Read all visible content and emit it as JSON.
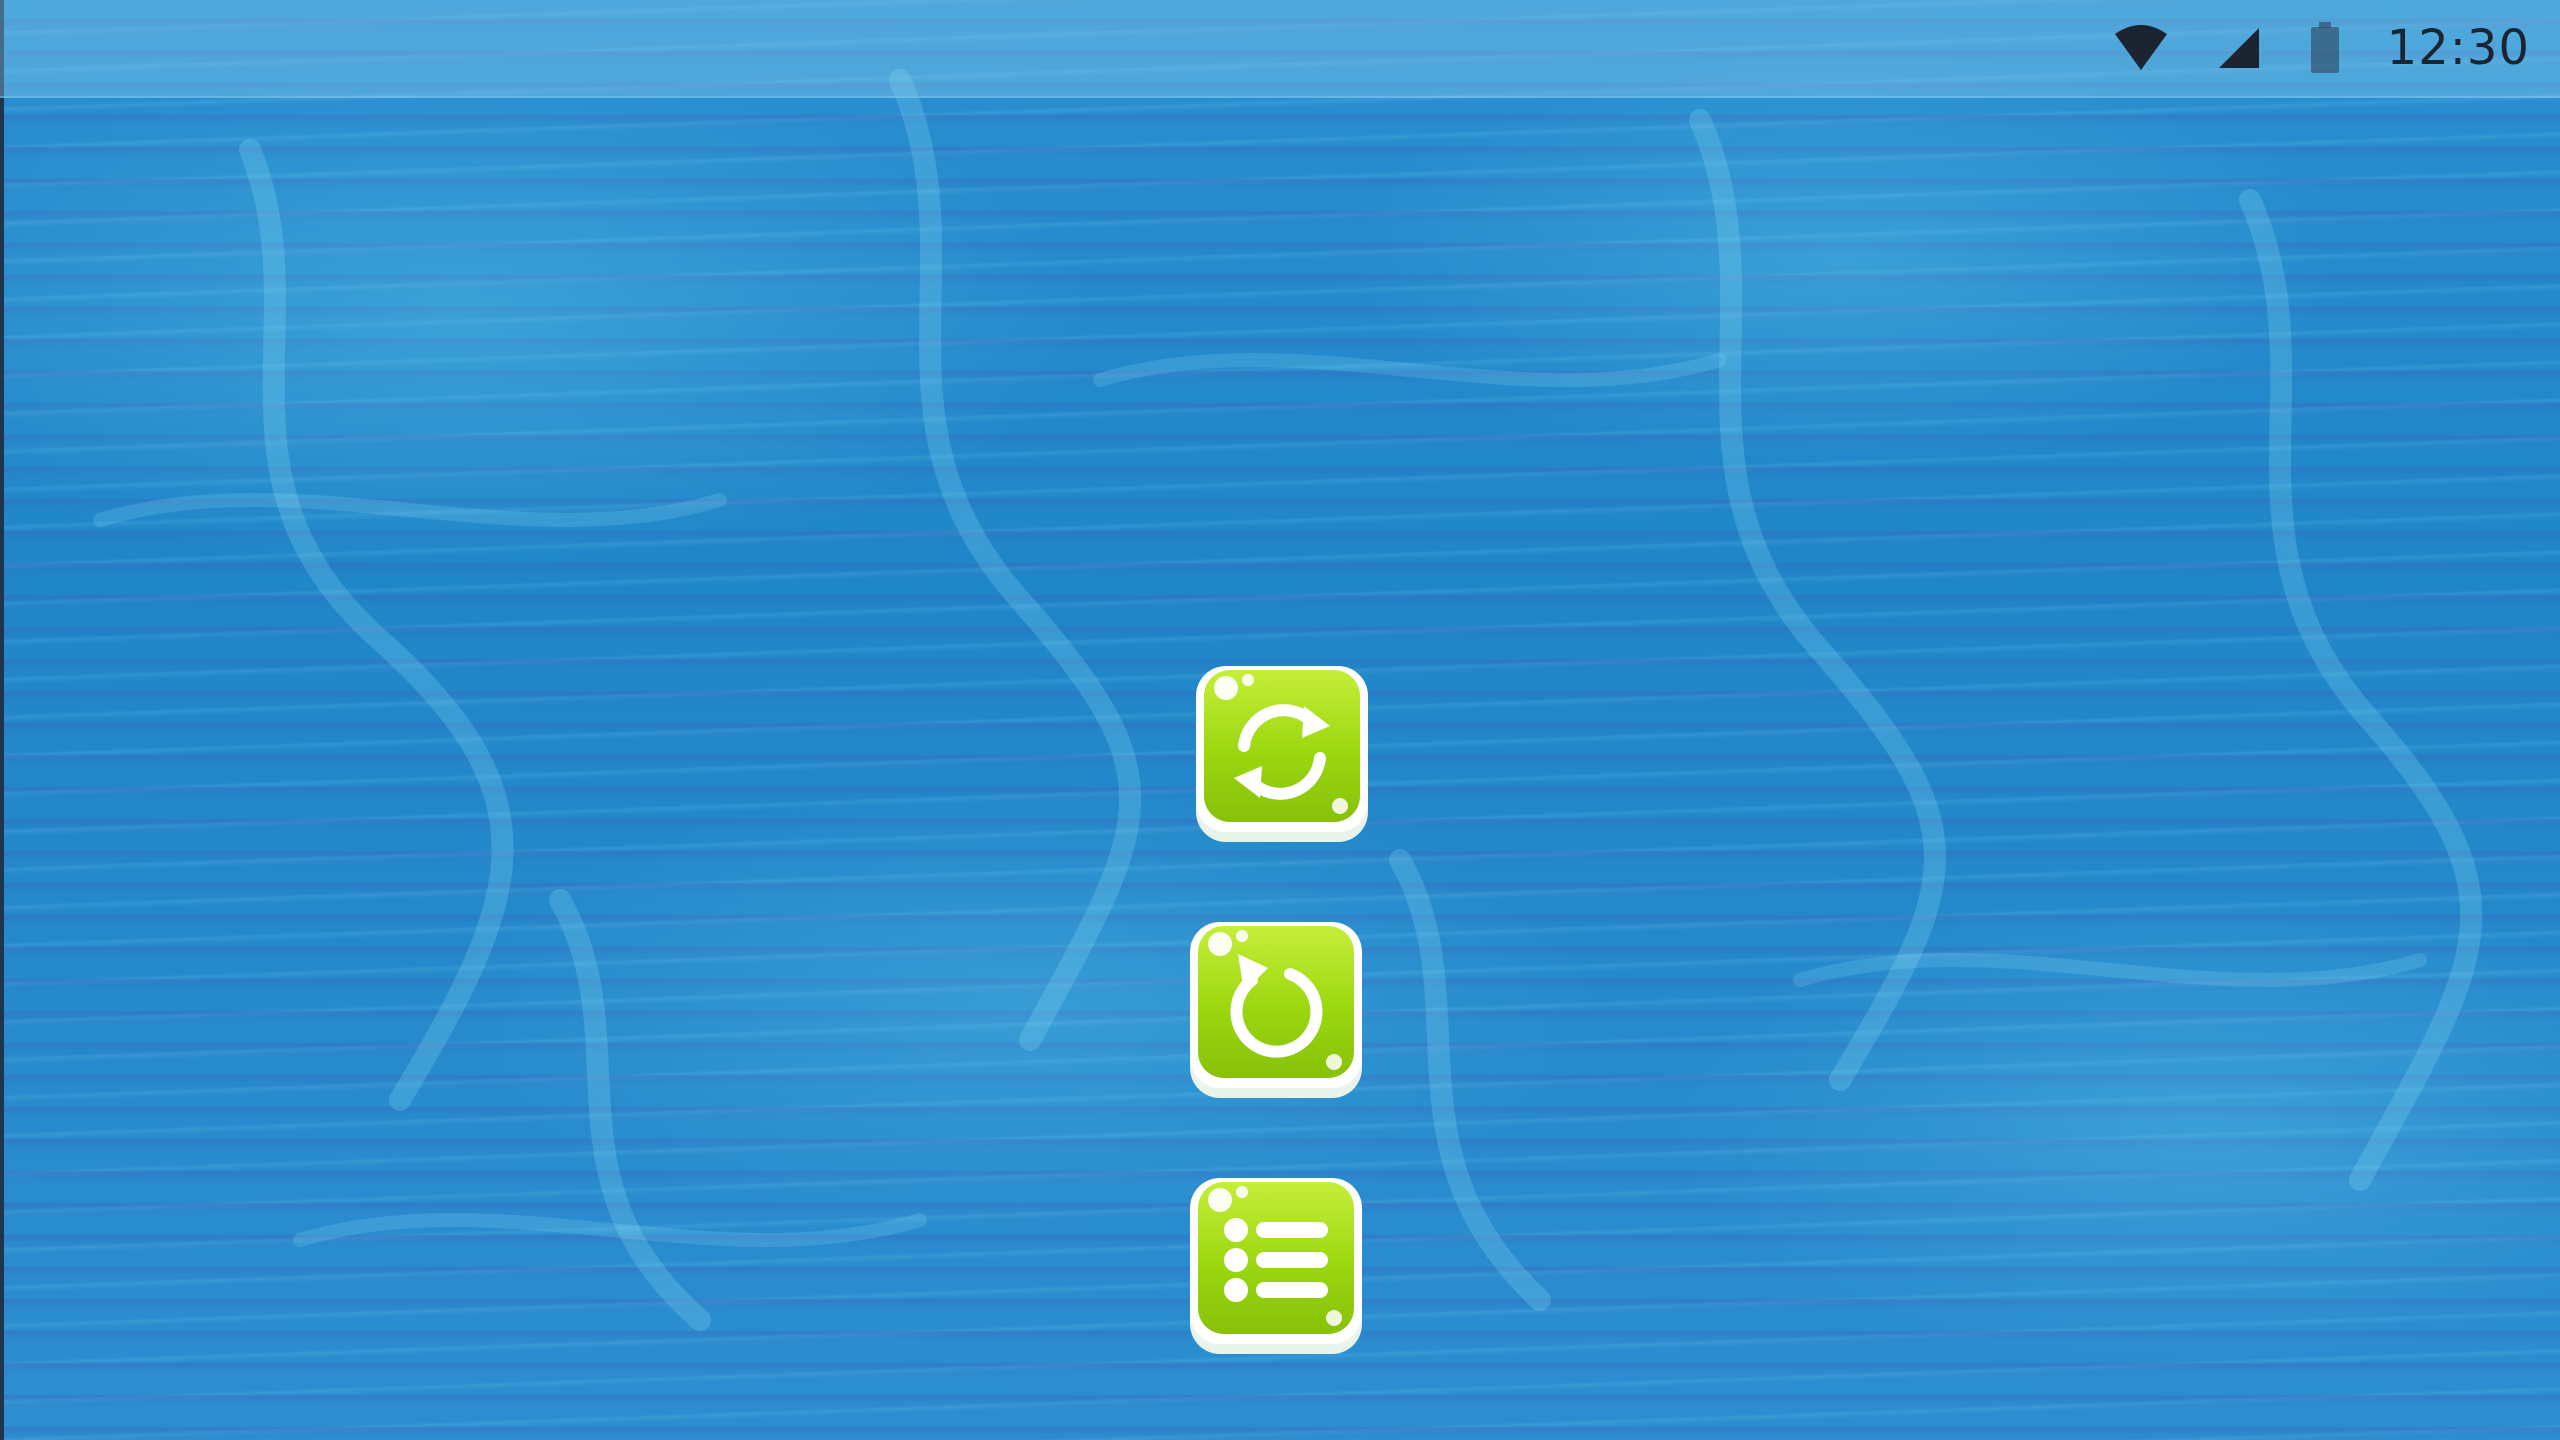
{
  "status_bar": {
    "time": "12:30",
    "icons": [
      "wifi-icon",
      "cellular-signal-icon",
      "battery-icon"
    ],
    "text_color": "#1b2430"
  },
  "background": {
    "theme": "water",
    "base_color": "#1f86c8"
  },
  "menu": {
    "buttons": [
      {
        "name": "refresh-button",
        "icon": "refresh-icon"
      },
      {
        "name": "restart-button",
        "icon": "restart-icon"
      },
      {
        "name": "level-list-button",
        "icon": "list-icon"
      }
    ],
    "button_color": "#9bd70f"
  }
}
